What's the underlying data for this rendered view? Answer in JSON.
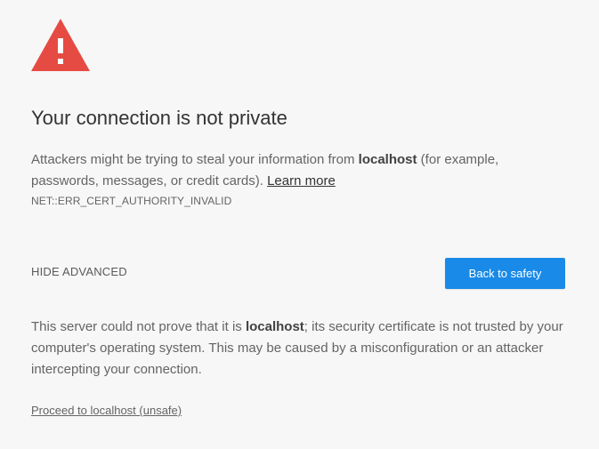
{
  "colors": {
    "background": "#f7f7f7",
    "warning_red": "#e64b43",
    "button_blue": "#1a8ae8"
  },
  "icon": "warning-triangle-icon",
  "title": "Your connection is not private",
  "explanation": {
    "part1": "Attackers might be trying to steal your information from ",
    "host": "localhost",
    "part2": " (for example, passwords, messages, or credit cards). ",
    "learn_more": "Learn more"
  },
  "error_code": "NET::ERR_CERT_AUTHORITY_INVALID",
  "hide_advanced_label": "HIDE ADVANCED",
  "back_to_safety_label": "Back to safety",
  "details": {
    "part1": "This server could not prove that it is ",
    "host": "localhost",
    "part2": "; its security certificate is not trusted by your computer's operating system. This may be caused by a misconfiguration or an attacker intercepting your connection."
  },
  "proceed_link": "Proceed to localhost (unsafe)"
}
